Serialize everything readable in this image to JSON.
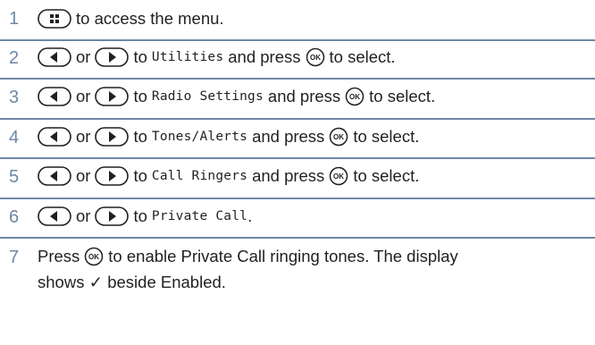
{
  "steps": [
    {
      "num": "1",
      "rest": "to access the menu."
    },
    {
      "num": "2",
      "or": "or",
      "to": "to",
      "item": "Utilities",
      "rest": "and press",
      "end": "to select."
    },
    {
      "num": "3",
      "or": "or",
      "to": "to",
      "item": "Radio Settings",
      "rest": "and press",
      "end": "to select."
    },
    {
      "num": "4",
      "or": "or",
      "to": "to",
      "item": "Tones/Alerts",
      "rest": "and press",
      "end": "to select."
    },
    {
      "num": "5",
      "or": "or",
      "to": "to",
      "item": "Call Ringers",
      "rest": "and press",
      "end": "to select."
    },
    {
      "num": "6",
      "or": "or",
      "to": "to",
      "item": "Private Call",
      "end": "."
    },
    {
      "num": "7",
      "pre": "Press",
      "rest": "to enable Private Call ringing tones. The display",
      "line2": "shows ✓ beside Enabled."
    }
  ],
  "icons": {
    "menu": "menu-key-icon",
    "left": "left-arrow-key-icon",
    "right": "right-arrow-key-icon",
    "ok": "ok-button-icon"
  },
  "colors": {
    "accent": "#6d88a6",
    "text": "#231f20"
  }
}
